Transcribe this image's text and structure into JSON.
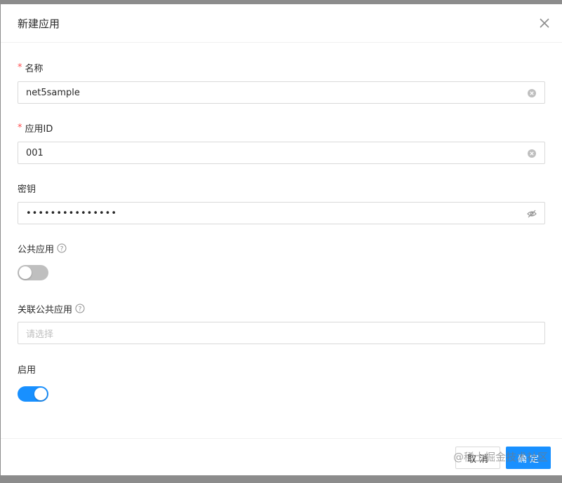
{
  "modal": {
    "title": "新建应用",
    "close_icon": "close-icon"
  },
  "form": {
    "name": {
      "required": "*",
      "label": "名称",
      "value": "net5sample"
    },
    "app_id": {
      "required": "*",
      "label": "应用ID",
      "value": "001"
    },
    "secret": {
      "label": "密钥",
      "value": "•••••••••••••••",
      "icon": "eye-invisible-icon"
    },
    "public_app": {
      "label": "公共应用",
      "icon": "question-circle-icon",
      "enabled": false
    },
    "linked_public_app": {
      "label": "关联公共应用",
      "icon": "question-circle-icon",
      "placeholder": "请选择"
    },
    "enable": {
      "label": "启用",
      "enabled": true
    }
  },
  "footer": {
    "cancel_label": "取 消",
    "ok_label": "确 定"
  },
  "watermark": "@稀土掘金技术社区",
  "colors": {
    "primary": "#1890ff",
    "required": "#ff4d4f",
    "switch_off": "#bfbfbf"
  }
}
